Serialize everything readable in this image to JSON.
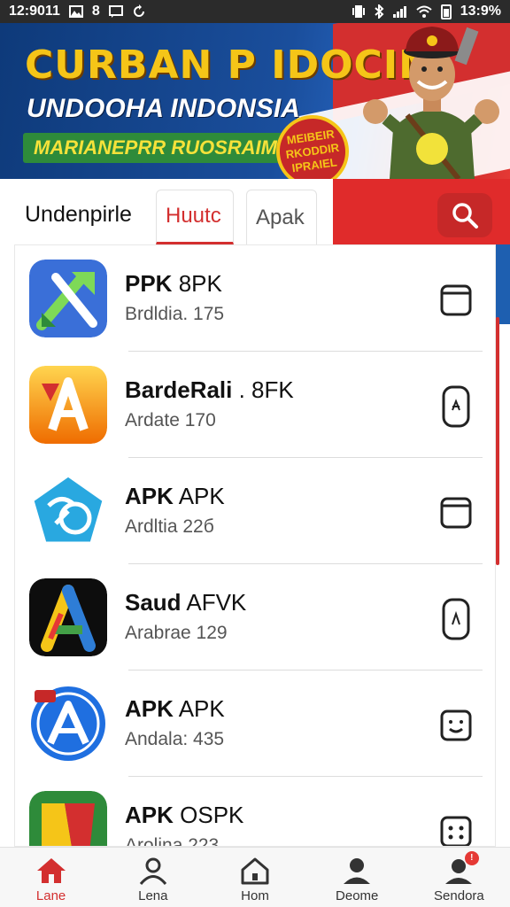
{
  "status_bar": {
    "time": "12:9011",
    "carrier_text": "8",
    "battery_text": "13:9%",
    "icons": [
      "photo-icon",
      "message-icon",
      "sync-icon",
      "vibrate-icon",
      "bluetooth-icon",
      "signal-icon",
      "wifi-icon",
      "battery-icon"
    ]
  },
  "banner": {
    "title": "CURBAN P IDOCIM",
    "subtitle": "UNDOOHA INDONSIA",
    "tag": "MARIANEPRR RUOSRAIMAS",
    "badge": "MEIBEIR RKODDIR IPRAIEL"
  },
  "tabs": {
    "plain": "Undenpirle",
    "active": "Huutc",
    "inactive": "Apak"
  },
  "apps": [
    {
      "name_bold": "PPK",
      "name_thin": " 8PK",
      "version": "Brdldia. 175",
      "icon": "arrow-app-icon",
      "action_icon": "square-icon"
    },
    {
      "name_bold": "BardeRali",
      "name_thin": " . 8FK",
      "version": "Ardate 170",
      "icon": "a-app-icon",
      "action_icon": "phone-icon"
    },
    {
      "name_bold": "APK",
      "name_thin": " APK",
      "version": "Ardltia 22б",
      "icon": "pentagon-app-icon",
      "action_icon": "square-icon"
    },
    {
      "name_bold": "Saud",
      "name_thin": " AFVK",
      "version": "Arabrae 129",
      "icon": "green-a-app-icon",
      "action_icon": "phone-icon"
    },
    {
      "name_bold": "APK",
      "name_thin": " APK",
      "version": "Andala: 435",
      "icon": "blue-a-app-icon",
      "action_icon": "smile-square-icon"
    },
    {
      "name_bold": "APK",
      "name_thin": " OSPK",
      "version": "Arolina 223",
      "icon": "flag-app-icon",
      "action_icon": "dots-square-icon"
    }
  ],
  "bottom_nav": [
    {
      "label": "Lane",
      "icon": "home-icon",
      "active": true
    },
    {
      "label": "Lena",
      "icon": "person-icon",
      "active": false
    },
    {
      "label": "Hom",
      "icon": "house-icon",
      "active": false
    },
    {
      "label": "Deome",
      "icon": "person-filled-icon",
      "active": false
    },
    {
      "label": "Sendora",
      "icon": "person-badge-icon",
      "active": false,
      "badge": "!"
    }
  ],
  "colors": {
    "accent": "#d32f2f",
    "banner_blue": "#1a4e9c",
    "banner_gold": "#f5c518"
  }
}
